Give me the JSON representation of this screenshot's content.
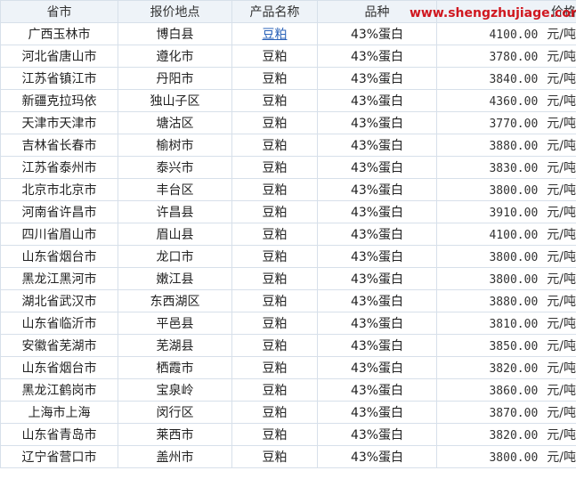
{
  "headers": [
    "省市",
    "报价地点",
    "产品名称",
    "品种",
    "价格"
  ],
  "watermark": "www.shengzhujiage.com",
  "rows": [
    {
      "province": "广西玉林市",
      "location": "博白县",
      "product": "豆粕",
      "variety": "43%蛋白",
      "price": "4100.00",
      "unit": "元/吨",
      "is_link": true
    },
    {
      "province": "河北省唐山市",
      "location": "遵化市",
      "product": "豆粕",
      "variety": "43%蛋白",
      "price": "3780.00",
      "unit": "元/吨",
      "is_link": false
    },
    {
      "province": "江苏省镇江市",
      "location": "丹阳市",
      "product": "豆粕",
      "variety": "43%蛋白",
      "price": "3840.00",
      "unit": "元/吨",
      "is_link": false
    },
    {
      "province": "新疆克拉玛依",
      "location": "独山子区",
      "product": "豆粕",
      "variety": "43%蛋白",
      "price": "4360.00",
      "unit": "元/吨",
      "is_link": false
    },
    {
      "province": "天津市天津市",
      "location": "塘沽区",
      "product": "豆粕",
      "variety": "43%蛋白",
      "price": "3770.00",
      "unit": "元/吨",
      "is_link": false
    },
    {
      "province": "吉林省长春市",
      "location": "榆树市",
      "product": "豆粕",
      "variety": "43%蛋白",
      "price": "3880.00",
      "unit": "元/吨",
      "is_link": false
    },
    {
      "province": "江苏省泰州市",
      "location": "泰兴市",
      "product": "豆粕",
      "variety": "43%蛋白",
      "price": "3830.00",
      "unit": "元/吨",
      "is_link": false
    },
    {
      "province": "北京市北京市",
      "location": "丰台区",
      "product": "豆粕",
      "variety": "43%蛋白",
      "price": "3800.00",
      "unit": "元/吨",
      "is_link": false
    },
    {
      "province": "河南省许昌市",
      "location": "许昌县",
      "product": "豆粕",
      "variety": "43%蛋白",
      "price": "3910.00",
      "unit": "元/吨",
      "is_link": false
    },
    {
      "province": "四川省眉山市",
      "location": "眉山县",
      "product": "豆粕",
      "variety": "43%蛋白",
      "price": "4100.00",
      "unit": "元/吨",
      "is_link": false
    },
    {
      "province": "山东省烟台市",
      "location": "龙口市",
      "product": "豆粕",
      "variety": "43%蛋白",
      "price": "3800.00",
      "unit": "元/吨",
      "is_link": false
    },
    {
      "province": "黑龙江黑河市",
      "location": "嫩江县",
      "product": "豆粕",
      "variety": "43%蛋白",
      "price": "3800.00",
      "unit": "元/吨",
      "is_link": false
    },
    {
      "province": "湖北省武汉市",
      "location": "东西湖区",
      "product": "豆粕",
      "variety": "43%蛋白",
      "price": "3880.00",
      "unit": "元/吨",
      "is_link": false
    },
    {
      "province": "山东省临沂市",
      "location": "平邑县",
      "product": "豆粕",
      "variety": "43%蛋白",
      "price": "3810.00",
      "unit": "元/吨",
      "is_link": false
    },
    {
      "province": "安徽省芜湖市",
      "location": "芜湖县",
      "product": "豆粕",
      "variety": "43%蛋白",
      "price": "3850.00",
      "unit": "元/吨",
      "is_link": false
    },
    {
      "province": "山东省烟台市",
      "location": "栖霞市",
      "product": "豆粕",
      "variety": "43%蛋白",
      "price": "3820.00",
      "unit": "元/吨",
      "is_link": false
    },
    {
      "province": "黑龙江鹤岗市",
      "location": "宝泉岭",
      "product": "豆粕",
      "variety": "43%蛋白",
      "price": "3860.00",
      "unit": "元/吨",
      "is_link": false
    },
    {
      "province": "上海市上海",
      "location": "闵行区",
      "product": "豆粕",
      "variety": "43%蛋白",
      "price": "3870.00",
      "unit": "元/吨",
      "is_link": false
    },
    {
      "province": "山东省青岛市",
      "location": "莱西市",
      "product": "豆粕",
      "variety": "43%蛋白",
      "price": "3820.00",
      "unit": "元/吨",
      "is_link": false
    },
    {
      "province": "辽宁省营口市",
      "location": "盖州市",
      "product": "豆粕",
      "variety": "43%蛋白",
      "price": "3800.00",
      "unit": "元/吨",
      "is_link": false
    }
  ]
}
